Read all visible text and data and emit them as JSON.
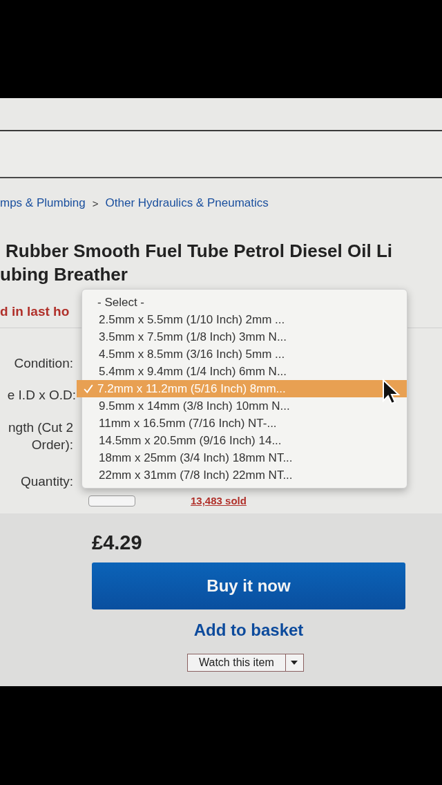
{
  "breadcrumb": {
    "items": [
      "mps & Plumbing",
      "Other Hydraulics & Pneumatics"
    ],
    "separator": ">"
  },
  "title": {
    "lines": [
      "Rubber Smooth Fuel Tube Petrol Diesel Oil Li",
      "ubing Breather"
    ]
  },
  "hint": "d in last ho",
  "fields": [
    {
      "label": "Condition:"
    },
    {
      "label": "e I.D x O.D:"
    },
    {
      "label": "ngth (Cut 2 Order):"
    },
    {
      "label": "Quantity:"
    }
  ],
  "sold": "13,483 sold",
  "dropdown": {
    "options": [
      {
        "label": "- Select -",
        "selected": false
      },
      {
        "label": "2.5mm x 5.5mm (1/10 Inch) 2mm ...",
        "selected": false
      },
      {
        "label": "3.5mm x 7.5mm (1/8 Inch) 3mm N...",
        "selected": false
      },
      {
        "label": "4.5mm x 8.5mm (3/16 Inch) 5mm ...",
        "selected": false
      },
      {
        "label": "5.4mm x 9.4mm (1/4 Inch) 6mm N...",
        "selected": false
      },
      {
        "label": "7.2mm x 11.2mm (5/16 Inch) 8mm...",
        "selected": true
      },
      {
        "label": "9.5mm x 14mm (3/8 Inch) 10mm N...",
        "selected": false
      },
      {
        "label": "11mm x 16.5mm (7/16 Inch) NT-...",
        "selected": false
      },
      {
        "label": "14.5mm x 20.5mm (9/16 Inch) 14...",
        "selected": false
      },
      {
        "label": "18mm x 25mm (3/4 Inch) 18mm NT...",
        "selected": false
      },
      {
        "label": "22mm x 31mm (7/8 Inch) 22mm NT...",
        "selected": false
      }
    ]
  },
  "price": "£4.29",
  "buy_button": "Buy it now",
  "basket_link": "Add to basket",
  "watch_button": "Watch this item"
}
